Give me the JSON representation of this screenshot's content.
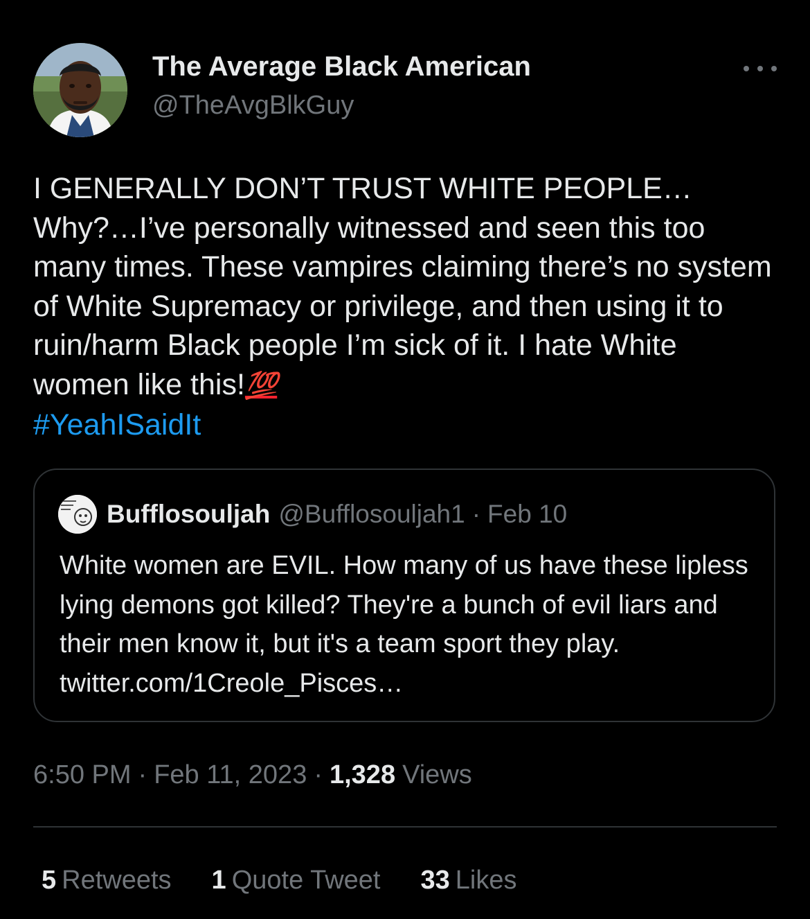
{
  "author": {
    "display_name": "The Average Black American",
    "handle": "@TheAvgBlkGuy"
  },
  "tweet": {
    "text": "I GENERALLY DON’T TRUST WHITE PEOPLE… Why?…I’ve personally witnessed and seen this too many times. These vampires claiming there’s no system of White Supremacy or privilege, and then using it to ruin/harm Black people I’m sick of it. I hate White women like this!",
    "emoji": "💯",
    "hashtag": "#YeahISaidIt"
  },
  "quoted_tweet": {
    "display_name": "Bufflosouljah",
    "handle": "@Bufflosouljah1",
    "separator": "·",
    "date": "Feb 10",
    "text": "White women are EVIL. How many of us have these lipless lying demons got killed? They're a bunch of evil liars and their men know it, but it's a team sport they play. twitter.com/1Creole_Pisces…"
  },
  "meta": {
    "time": "6:50 PM",
    "separator": "·",
    "date": "Feb 11, 2023",
    "views_count": "1,328",
    "views_label": "Views"
  },
  "stats": [
    {
      "count": "5",
      "label": "Retweets"
    },
    {
      "count": "1",
      "label": "Quote Tweet"
    },
    {
      "count": "33",
      "label": "Likes"
    }
  ],
  "colors": {
    "background": "#000000",
    "text": "#e7e9ea",
    "secondary": "#71767b",
    "link": "#1d9bf0",
    "border": "#2f3336",
    "emoji_red": "#f4212e"
  },
  "icons": {
    "more": "more-horizontal-icon",
    "hundred": "hundred-points-emoji"
  }
}
